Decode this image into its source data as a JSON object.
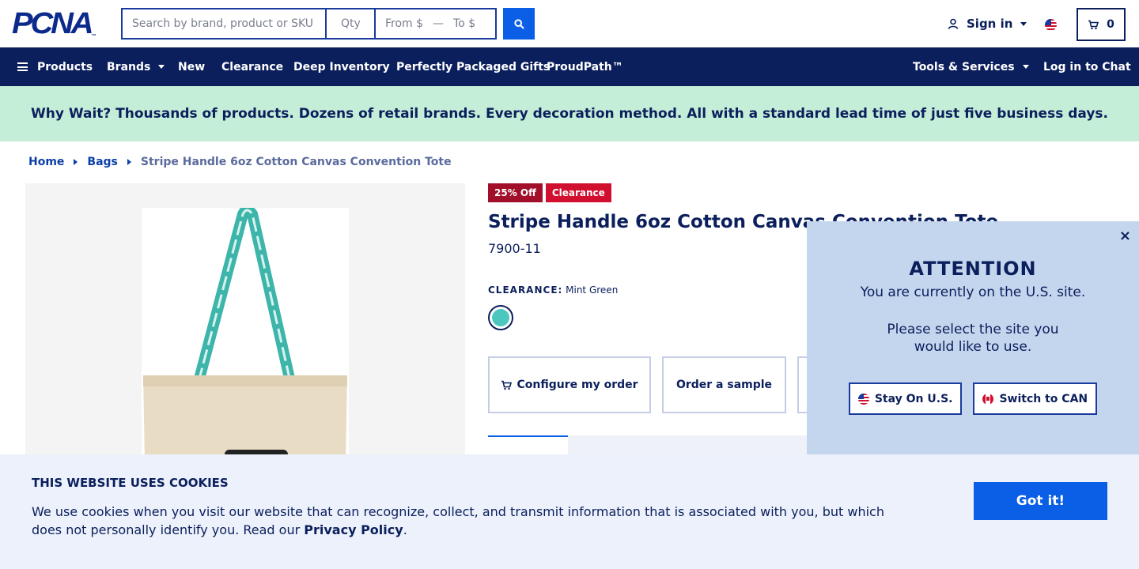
{
  "header": {
    "logo_text": "PCNA",
    "search_placeholder": "Search by brand, product or SKU",
    "qty_placeholder": "Qty",
    "price_from_placeholder": "From $",
    "price_to_placeholder": "To $",
    "signin_label": "Sign in",
    "cart_count": "0"
  },
  "nav": {
    "products": "Products",
    "brands": "Brands",
    "new": "New",
    "clearance": "Clearance",
    "deep_inventory": "Deep Inventory",
    "packaged_gifts": "Perfectly Packaged Gifts",
    "proudpath": "ProudPath™",
    "tools": "Tools & Services",
    "chat": "Log in to Chat"
  },
  "promo": {
    "text": "Why Wait? Thousands of products. Dozens of retail brands. Every decoration method. All with a standard lead time of just five business days."
  },
  "breadcrumb": {
    "home": "Home",
    "bags": "Bags",
    "current": "Stripe Handle 6oz Cotton Canvas Convention Tote"
  },
  "product": {
    "badge_off": "25% Off",
    "badge_clearance": "Clearance",
    "title": "Stripe Handle 6oz Cotton Canvas Convention Tote",
    "sku": "7900-11",
    "color_heading": "CLEARANCE:",
    "color_name": "Mint Green",
    "swatch_color": "#4cc7c0",
    "configure_label": "Configure my order",
    "sample_label": "Order a sample"
  },
  "attention": {
    "close": "×",
    "title": "ATTENTION",
    "line1": "You are currently on the U.S. site.",
    "line2": "Please select the site you would like to use.",
    "stay_label": "Stay On U.S.",
    "switch_label": "Switch to CAN"
  },
  "cookie": {
    "title": "THIS WEBSITE USES COOKIES",
    "body": "We use cookies when you visit our website that can recognize, collect, and transmit information that is associated with you, but which does not personally identify you. Read our ",
    "policy_link": "Privacy Policy",
    "period": ".",
    "button_label": "Got it!"
  },
  "colors": {
    "navy": "#0b1f5c",
    "accent_blue": "#0a5fe6",
    "promo_bg": "#c5eed8",
    "badge_red": "#d0102e"
  }
}
